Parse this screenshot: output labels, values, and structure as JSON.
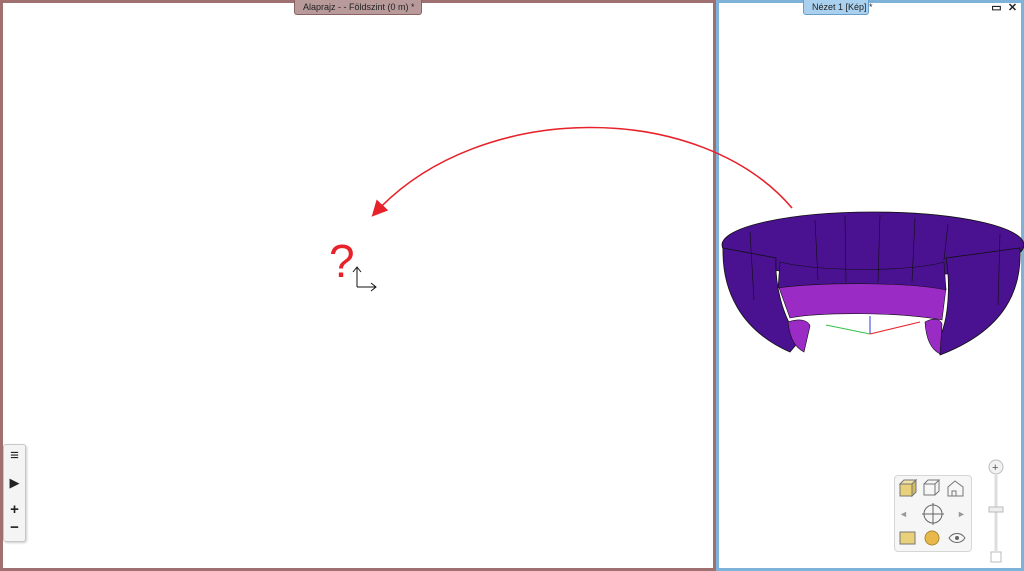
{
  "plan_view": {
    "tab_title": "Alaprajz -  - Földszint (0 m) *",
    "marker": "?"
  },
  "view_3d": {
    "tab_title": "Nézet 1 [Kép] *",
    "object_color_outer": "#4a1191",
    "object_color_inner": "#9a2bc4"
  },
  "window_controls": {
    "restore": "▭",
    "close": "✕"
  },
  "left_toolbar": {
    "list_icon": "≡",
    "play_icon": "▶",
    "zoom_in": "+",
    "zoom_out": "−"
  },
  "zoom_slider": {
    "plus": "+"
  },
  "colors": {
    "plan_border": "#a07070",
    "view_border": "#7fb2d8",
    "arrow": "#e8222a"
  }
}
